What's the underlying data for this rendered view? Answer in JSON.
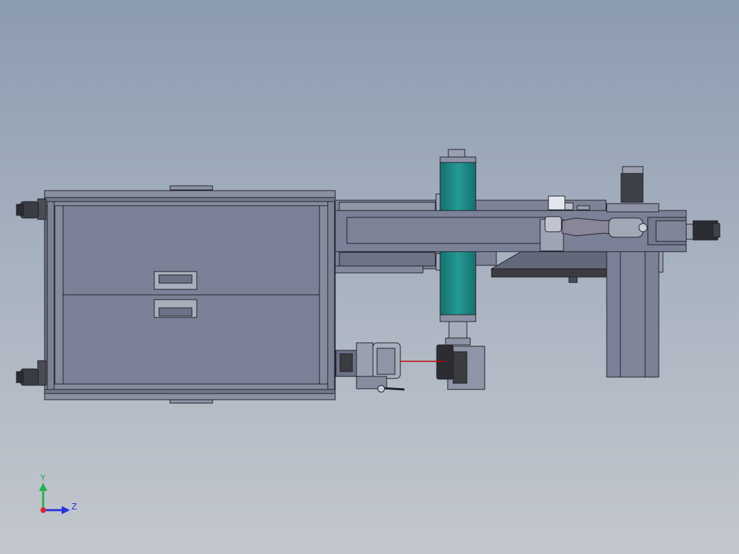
{
  "triad": {
    "y_label": "Y",
    "z_label": "Z",
    "y_color": "#22b14c",
    "z_color": "#2233dd",
    "x_color": "#dd2222"
  },
  "model": {
    "body_color": "#7b8196",
    "frame_color": "#6c7286",
    "edge_color": "#1e2028",
    "column_color": "#1e8a86",
    "hood_color": "#3a3c40",
    "laser_color": "#c00000",
    "motor_color": "#2b2d33"
  }
}
